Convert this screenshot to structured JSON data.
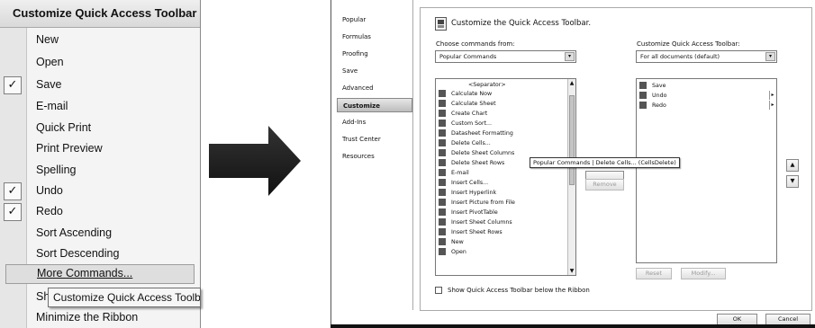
{
  "left_menu": {
    "header": "Customize Quick Access Toolbar",
    "items": [
      {
        "label": "New",
        "checked": false
      },
      {
        "label": "Open",
        "checked": false
      },
      {
        "label": "Save",
        "checked": true
      },
      {
        "label": "E-mail",
        "checked": false
      },
      {
        "label": "Quick Print",
        "checked": false
      },
      {
        "label": "Print Preview",
        "checked": false
      },
      {
        "label": "Spelling",
        "checked": false
      },
      {
        "label": "Undo",
        "checked": true
      },
      {
        "label": "Redo",
        "checked": true
      },
      {
        "label": "Sort Ascending",
        "checked": false
      },
      {
        "label": "Sort Descending",
        "checked": false
      },
      {
        "label": "More Commands...",
        "checked": false,
        "hover": true
      },
      {
        "label": "Sh",
        "checked": false
      },
      {
        "label": "Minimize the Ribbon",
        "checked": false
      }
    ],
    "tooltip": "Customize Quick Access Toolbar",
    "check_glyph": "✓"
  },
  "dialog": {
    "nav": [
      "Popular",
      "Formulas",
      "Proofing",
      "Save",
      "Advanced",
      "Customize",
      "Add-Ins",
      "Trust Center",
      "Resources"
    ],
    "selected_nav": "Customize",
    "title": "Customize the Quick Access Toolbar.",
    "choose_label": "Choose commands from:",
    "choose_value": "Popular Commands",
    "customize_label": "Customize Quick Access Toolbar:",
    "customize_value": "For all documents (default)",
    "commands": [
      "<Separator>",
      "Calculate Now",
      "Calculate Sheet",
      "Create Chart",
      "Custom Sort...",
      "Datasheet Formatting",
      "Delete Cells...",
      "Delete Sheet Columns",
      "Delete Sheet Rows",
      "E-mail",
      "Insert Cells...",
      "Insert Hyperlink",
      "Insert Picture from File",
      "Insert PivotTable",
      "Insert Sheet Columns",
      "Insert Sheet Rows",
      "New",
      "Open"
    ],
    "toolbar_items": [
      "Save",
      "Undo",
      "Redo"
    ],
    "tooltip": "Popular Commands | Delete Cells... (CellsDelete)",
    "remove_button": "Remove",
    "reset_button": "Reset",
    "modify_button": "Modify...",
    "show_below_label": "Show Quick Access Toolbar below the Ribbon",
    "ok_button": "OK",
    "cancel_button": "Cancel",
    "up_glyph": "▲",
    "down_glyph": "▼",
    "dropdown_glyph": "▾",
    "list_scroll_up_glyph": "▲",
    "list_scroll_down_glyph": "▼",
    "toolbar_arrow_glyph": "▸"
  }
}
